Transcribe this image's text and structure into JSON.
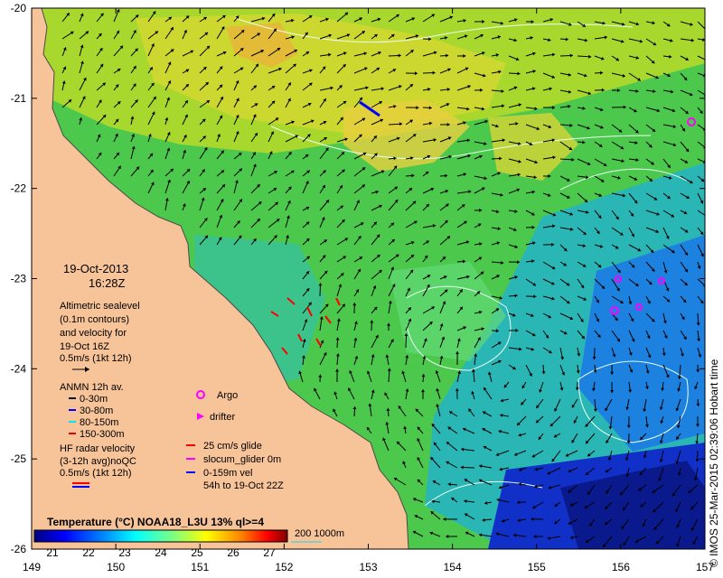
{
  "map": {
    "title_date": "19-Oct-2013",
    "title_time": "16:28Z",
    "x_ticks": [
      "149",
      "150",
      "151",
      "152",
      "153",
      "154",
      "155",
      "156",
      "157"
    ],
    "y_ticks": [
      "-20",
      "-21",
      "-22",
      "-23",
      "-24",
      "-25",
      "-26"
    ],
    "x_range": [
      149,
      157
    ],
    "y_range": [
      -26,
      -20
    ],
    "land_color": "#f7c399"
  },
  "legend": {
    "altimetry": {
      "lines": [
        "Altimetric sealevel",
        "(0.1m contours)",
        "and velocity for",
        "19-Oct 16Z"
      ],
      "scale": "0.5m/s (1kt 12h)"
    },
    "anmn": {
      "title": "ANMN 12h av.",
      "items": [
        {
          "label": "0-30m",
          "color": "#000000"
        },
        {
          "label": "30-80m",
          "color": "#0000ff"
        },
        {
          "label": "80-150m",
          "color": "#00e5e5"
        },
        {
          "label": "150-300m",
          "color": "#e00000"
        }
      ]
    },
    "hf_radar": {
      "lines": [
        "HF radar velocity",
        "(3-12h avg)noQC"
      ],
      "scale": "0.5m/s (1kt 12h)"
    },
    "argo": {
      "label": "Argo",
      "color": "#ff00ff"
    },
    "drifter": {
      "label": "drifter",
      "color": "#ff00ff"
    },
    "glider": {
      "lines": [
        "25 cm/s glide",
        "slocum_glider 0m",
        "0-159m vel",
        "54h to 19-Oct 22Z"
      ],
      "colors": [
        "#ff0000",
        "#ff00ff",
        "#0000ff"
      ]
    },
    "colorbar": {
      "title": "Temperature (°C) NOAA18_L3U 13% ql>=4",
      "ticks": [
        "21",
        "22",
        "23",
        "24",
        "25",
        "26",
        "27"
      ],
      "range": [
        20.5,
        27.5
      ]
    },
    "bathymetry": {
      "label": "200  1000m",
      "color": "#66cccc"
    }
  },
  "credit": "© IMOS 25-Mar-2015 02:39:06 Hobart time"
}
